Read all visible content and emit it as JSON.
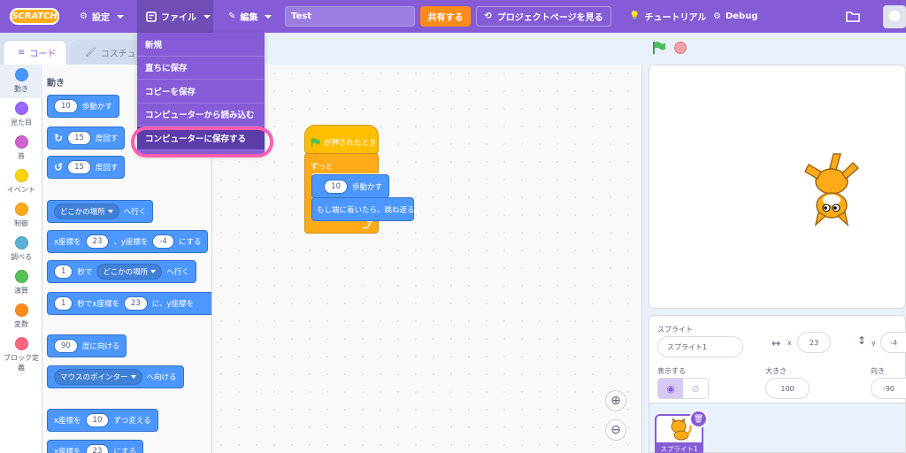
{
  "menubar": {
    "logo": "SCRATCH",
    "settings_label": "設定",
    "file_label": "ファイル",
    "edit_label": "編集",
    "project_title": "Test",
    "share_label": "共有する",
    "project_page_label": "プロジェクトページを見る",
    "tutorial_label": "チュートリアル",
    "debug_label": "Debug"
  },
  "file_menu": {
    "items": [
      "新規",
      "直ちに保存",
      "コピーを保存",
      "コンピューターから読み込む",
      "コンピューターに保存する"
    ],
    "highlighted_index": 4
  },
  "tabs": {
    "code_label": "コード",
    "costume_label": "コスチューム"
  },
  "categories": [
    {
      "label": "動き",
      "color": "#4c97ff"
    },
    {
      "label": "見た目",
      "color": "#9966ff"
    },
    {
      "label": "音",
      "color": "#cf63cf"
    },
    {
      "label": "イベント",
      "color": "#ffd500"
    },
    {
      "label": "制御",
      "color": "#ffab19"
    },
    {
      "label": "調べる",
      "color": "#5cb1d6"
    },
    {
      "label": "演算",
      "color": "#59c059"
    },
    {
      "label": "変数",
      "color": "#ff8c1a"
    },
    {
      "label": "ブロック定義",
      "color": "#ff6680"
    }
  ],
  "palette": {
    "heading": "動き",
    "move": {
      "value": "10",
      "text": "歩動かす"
    },
    "turn_right": {
      "value": "15",
      "text": "度回す"
    },
    "turn_left": {
      "value": "15",
      "text": "度回す"
    },
    "goto": {
      "dropdown": "どこかの場所",
      "text": "へ行く"
    },
    "goto_xy": {
      "x_label": "x座標を",
      "x": "23",
      "y_label": "、y座標を",
      "y": "-4",
      "text": "にする"
    },
    "glide": {
      "secs": "1",
      "secs_label": "秒で",
      "dropdown": "どこかの場所",
      "text": "へ行く"
    },
    "glide_xy": {
      "secs": "1",
      "label": "秒でx座標を",
      "x": "23",
      "mid": "に、y座標を"
    },
    "point_dir": {
      "value": "90",
      "text": "度に向ける"
    },
    "point_towards": {
      "dropdown": "マウスのポインター",
      "text": "へ向ける"
    },
    "change_x": {
      "label": "x座標を",
      "value": "10",
      "text": "ずつ変える"
    },
    "set_x": {
      "label": "x座標を",
      "value": "23",
      "text": "にする"
    }
  },
  "script": {
    "hat_text": "が押されたとき",
    "forever_label": "ずっと",
    "move": {
      "value": "10",
      "text": "歩動かす"
    },
    "bounce_text": "もし端に着いたら、跳ね返る"
  },
  "sprite_info": {
    "sprite_label": "スプライト",
    "sprite_name": "スプライト1",
    "x_label": "x",
    "x": "23",
    "y_label": "y",
    "y": "-4",
    "show_label": "表示する",
    "size_label": "大きさ",
    "size": "100",
    "direction_label": "向き",
    "direction": "-90"
  },
  "sprite_list": {
    "thumb_label": "スプライト1"
  },
  "colors": {
    "accent": "#855cd6",
    "motion": "#4c97ff",
    "events": "#ffbf00",
    "control": "#ffab19",
    "highlight": "#ff5fb3"
  }
}
